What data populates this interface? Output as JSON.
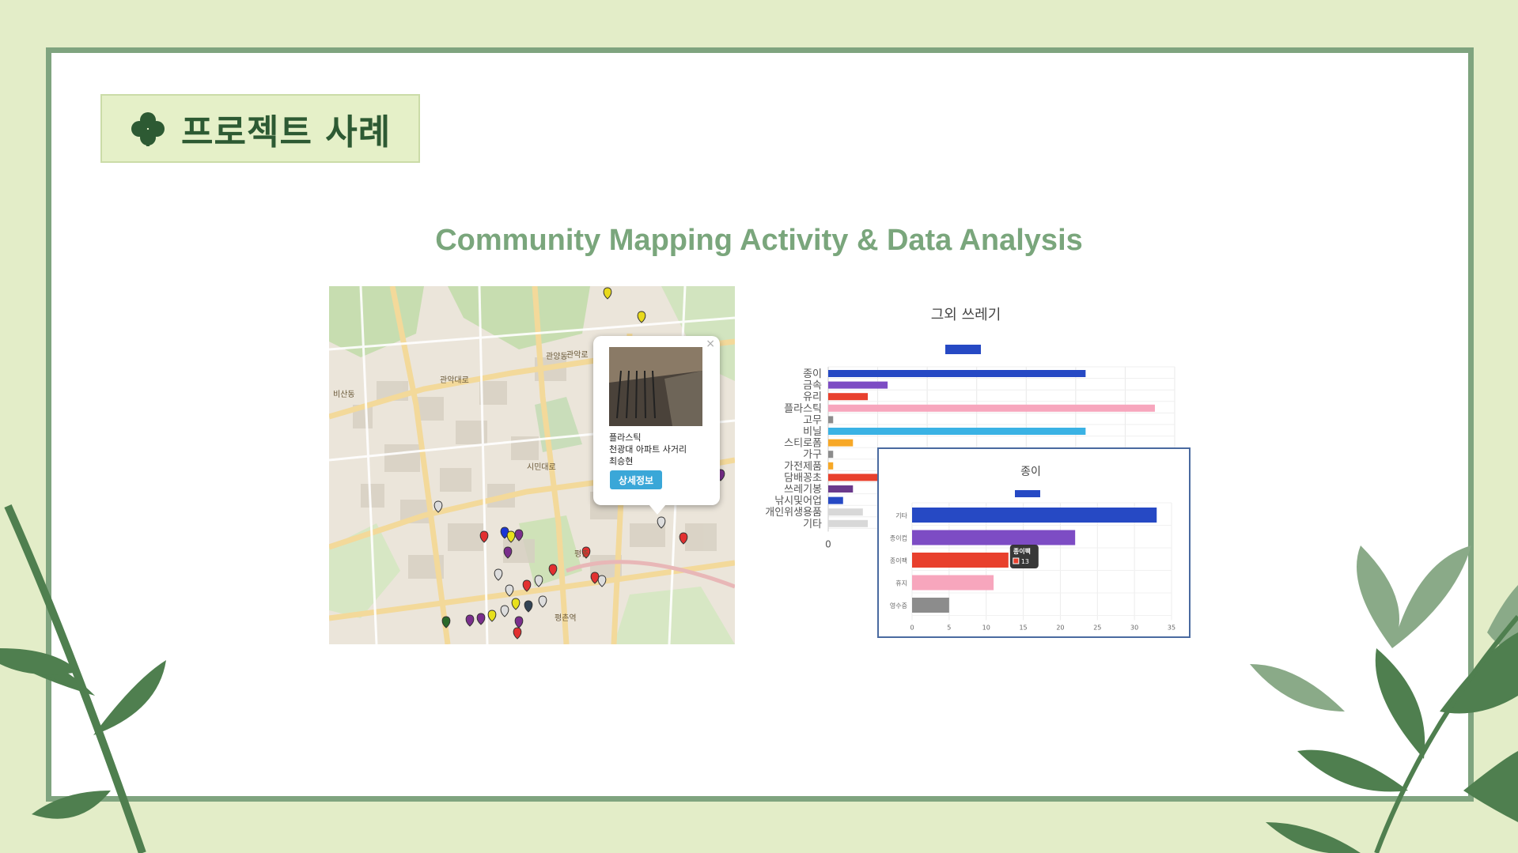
{
  "page": {
    "title": "프로젝트 사례",
    "subtitle": "Community Mapping Activity & Data Analysis"
  },
  "colors": {
    "background": "#e3edc8",
    "frame": "#7fa47f",
    "title_text": "#2d5a33",
    "subtitle_text": "#7aa67c",
    "leaf_dark": "#4f7f4f",
    "leaf_light": "#8aaa88"
  },
  "map": {
    "popup": {
      "close": "×",
      "category": "플라스틱",
      "location": "천광대 아파트 사거리",
      "author": "최승현",
      "button_label": "상세정보"
    },
    "labels": [
      "관악로",
      "관양동",
      "관악대로",
      "평촌",
      "평촌역",
      "비산동",
      "시민대로",
      "관악로"
    ]
  },
  "chart_data": [
    {
      "type": "bar",
      "orientation": "horizontal",
      "title": "그외 쓰레기",
      "categories": [
        "종이",
        "금속",
        "유리",
        "플라스틱",
        "고무",
        "비닐",
        "스티로폼",
        "가구",
        "가전제품",
        "담배꽁초",
        "쓰레기봉",
        "낚시및어업",
        "개인위생용품",
        "기타"
      ],
      "values": [
        26,
        6,
        4,
        33,
        0.5,
        26,
        2.5,
        0.5,
        0.5,
        5,
        2.5,
        1.5,
        3.5,
        4
      ],
      "colors": [
        "#2649c4",
        "#7d4cc4",
        "#e8402d",
        "#f7a6bd",
        "#8c8c8c",
        "#3ab2e4",
        "#f7a827",
        "#8c8c8c",
        "#f7a827",
        "#e8402d",
        "#6a3a8c",
        "#2649c4",
        "#d8d8d8",
        "#d8d8d8"
      ],
      "xtick_labels": [
        "0"
      ],
      "xlim": [
        0,
        35
      ]
    },
    {
      "type": "bar",
      "orientation": "horizontal",
      "title": "종이",
      "categories": [
        "기타",
        "종이컵",
        "종이팩",
        "휴지",
        "영수증"
      ],
      "values": [
        33,
        22,
        13,
        11,
        5
      ],
      "colors": [
        "#2649c4",
        "#7d4cc4",
        "#e8402d",
        "#f7a6bd",
        "#8c8c8c"
      ],
      "xticks": [
        0,
        5,
        10,
        15,
        20,
        25,
        30,
        35
      ],
      "xlim": [
        0,
        35
      ],
      "tooltip": {
        "label": "종이팩",
        "value": "13"
      }
    }
  ]
}
